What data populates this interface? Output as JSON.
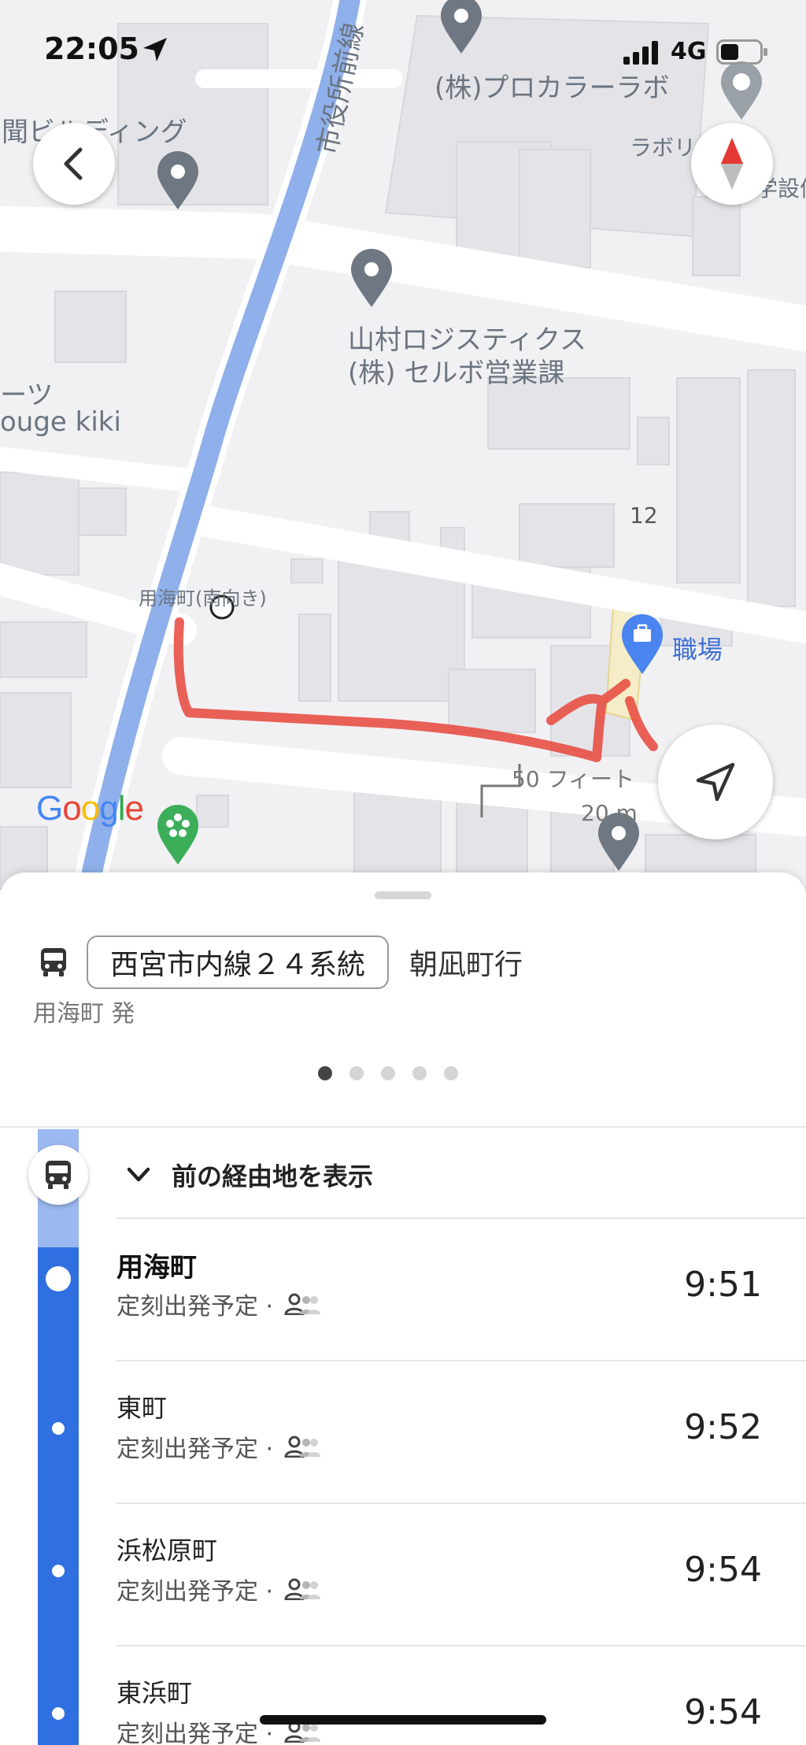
{
  "status_bar": {
    "time": "22:05",
    "network": "4G"
  },
  "map": {
    "labels": {
      "road": "市役所前線",
      "procolor": "(株)プロカラーラボ",
      "building_left": "聞ビルディング",
      "labori": "ラボリ",
      "sekkei": "学設億",
      "yamamura_1": "山村ロジスティクス",
      "yamamura_2": "(株) セルボ営業課",
      "sports": "ーツ",
      "rouge": "ouge kiki",
      "block_number": "12",
      "bus_stop": "用海町(南向き)",
      "workplace": "職場",
      "scale_feet": "50 フィート",
      "scale_meters": "20 m",
      "google": "Google"
    },
    "colors": {
      "route_line": "#e8473b",
      "road_blue": "#8fb0ea",
      "workplace_pin": "#4a84f0"
    }
  },
  "sheet": {
    "line_name": "西宮市内線２４系統",
    "destination": "朝凪町行",
    "origin": "用海町 発",
    "pager_total": 5,
    "pager_active": 0,
    "show_previous_label": "前の経由地を表示",
    "stops": [
      {
        "name": "用海町",
        "status": "定刻出発予定 ·",
        "time": "9:51",
        "current": true
      },
      {
        "name": "東町",
        "status": "定刻出発予定 ·",
        "time": "9:52",
        "current": false
      },
      {
        "name": "浜松原町",
        "status": "定刻出発予定 ·",
        "time": "9:54",
        "current": false
      },
      {
        "name": "東浜町",
        "status": "定刻出発予定 ·",
        "time": "9:54",
        "current": false
      }
    ]
  }
}
